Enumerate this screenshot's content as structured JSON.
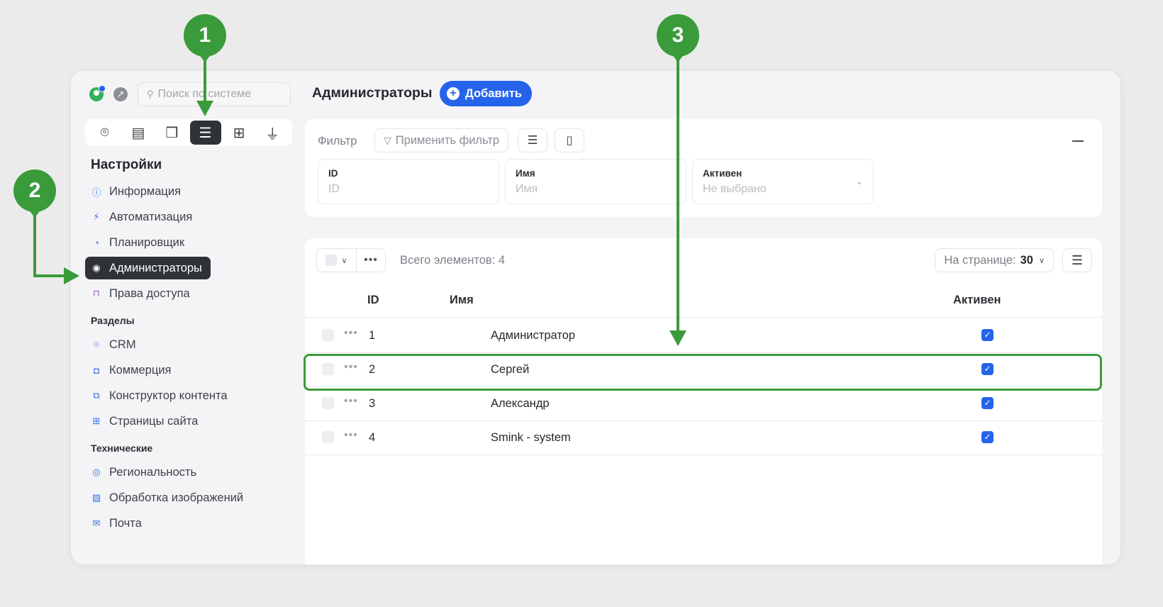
{
  "sidebar": {
    "search_placeholder": "Поиск по системе",
    "tabs": [
      {
        "icon": "crm-icon"
      },
      {
        "icon": "content-icon"
      },
      {
        "icon": "book-icon"
      },
      {
        "icon": "settings-sliders-icon",
        "active": true
      },
      {
        "icon": "add-box-icon"
      },
      {
        "icon": "brush-icon"
      }
    ],
    "section_title": "Настройки",
    "settings_items": [
      {
        "label": "Информация",
        "icon": "info-icon"
      },
      {
        "label": "Автоматизация",
        "icon": "automation-icon"
      },
      {
        "label": "Планировщик",
        "icon": "scheduler-icon"
      },
      {
        "label": "Администраторы",
        "icon": "user-circle-icon",
        "active": true
      },
      {
        "label": "Права доступа",
        "icon": "lock-open-icon"
      }
    ],
    "sections_label": "Разделы",
    "sections_items": [
      {
        "label": "CRM",
        "icon": "crm-icon"
      },
      {
        "label": "Коммерция",
        "icon": "bag-icon"
      },
      {
        "label": "Конструктор контента",
        "icon": "copy-icon"
      },
      {
        "label": "Страницы сайта",
        "icon": "grid-icon"
      }
    ],
    "technical_label": "Технические",
    "technical_items": [
      {
        "label": "Региональность",
        "icon": "location-icon"
      },
      {
        "label": "Обработка изображений",
        "icon": "image-icon"
      },
      {
        "label": "Почта",
        "icon": "mail-icon"
      }
    ]
  },
  "main": {
    "title": "Администраторы",
    "add_label": "Добавить",
    "filter": {
      "label": "Фильтр",
      "apply_label": "Применить фильтр",
      "fields": [
        {
          "label": "ID",
          "placeholder": "ID"
        },
        {
          "label": "Имя",
          "placeholder": "Имя"
        },
        {
          "label": "Активен",
          "value": "Не выбрано"
        }
      ]
    },
    "table": {
      "total_label": "Всего элементов: 4",
      "per_page_label": "На странице:",
      "per_page_value": "30",
      "columns": [
        "ID",
        "Имя",
        "Активен"
      ],
      "rows": [
        {
          "id": "1",
          "name": "Администратор",
          "active": true
        },
        {
          "id": "2",
          "name": "Сергей",
          "active": true
        },
        {
          "id": "3",
          "name": "Александр",
          "active": true
        },
        {
          "id": "4",
          "name": "Smink - system",
          "active": true
        }
      ]
    }
  },
  "annotations": {
    "badge_1": "1",
    "badge_2": "2",
    "badge_3": "3",
    "color": "#3a9b3a"
  }
}
